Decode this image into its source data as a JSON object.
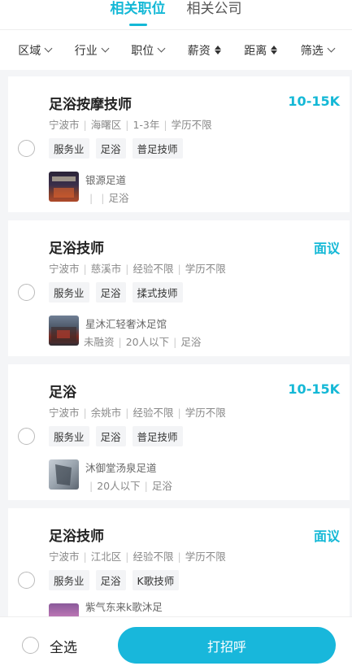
{
  "tabs": [
    {
      "label": "相关职位",
      "active": true
    },
    {
      "label": "相关公司",
      "active": false
    }
  ],
  "filters": [
    {
      "label": "区域",
      "icon": "chevron-down-icon"
    },
    {
      "label": "行业",
      "icon": "chevron-down-icon"
    },
    {
      "label": "职位",
      "icon": "chevron-down-icon"
    },
    {
      "label": "薪资",
      "icon": "sort-icon"
    },
    {
      "label": "距离",
      "icon": "sort-icon"
    },
    {
      "label": "筛选",
      "icon": "chevron-down-icon"
    }
  ],
  "jobs": [
    {
      "title": "足浴按摩技师",
      "salary": "10-15K",
      "meta": [
        "宁波市",
        "海曙区",
        "1-3年",
        "学历不限"
      ],
      "tags": [
        "服务业",
        "足浴",
        "普足技师"
      ],
      "company": {
        "name": "银源足道",
        "meta": [
          "",
          "",
          "足浴"
        ]
      }
    },
    {
      "title": "足浴技师",
      "salary": "面议",
      "meta": [
        "宁波市",
        "慈溪市",
        "经验不限",
        "学历不限"
      ],
      "tags": [
        "服务业",
        "足浴",
        "揉式技师"
      ],
      "company": {
        "name": "星沐汇轻奢沐足馆",
        "meta": [
          "未融资",
          "20人以下",
          "足浴"
        ]
      }
    },
    {
      "title": "足浴",
      "salary": "10-15K",
      "meta": [
        "宁波市",
        "余姚市",
        "经验不限",
        "学历不限"
      ],
      "tags": [
        "服务业",
        "足浴",
        "普足技师"
      ],
      "company": {
        "name": "沐御堂汤泉足道",
        "meta": [
          "",
          "20人以下",
          "足浴"
        ]
      }
    },
    {
      "title": "足浴技师",
      "salary": "面议",
      "meta": [
        "宁波市",
        "江北区",
        "经验不限",
        "学历不限"
      ],
      "tags": [
        "服务业",
        "足浴",
        "K歌技师"
      ],
      "company": {
        "name": "紫气东来k歌沐足",
        "meta": []
      }
    }
  ],
  "bottom": {
    "select_all": "全选",
    "greet_button": "打招呼"
  },
  "colors": {
    "accent": "#14b8d6",
    "button": "#18b7db"
  }
}
